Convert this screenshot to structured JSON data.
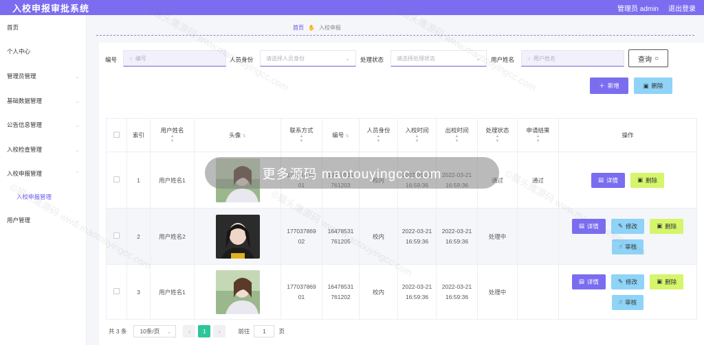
{
  "header": {
    "title": "入校申报审批系统",
    "admin_label": "管理员 admin",
    "logout_label": "退出登录"
  },
  "sidebar": {
    "items": [
      {
        "label": "首页"
      },
      {
        "label": "个人中心"
      },
      {
        "label": "管理员管理"
      },
      {
        "label": "基础数据管理"
      },
      {
        "label": "公告信息管理"
      },
      {
        "label": "入校检查管理"
      },
      {
        "label": "入校申报管理"
      },
      {
        "label": "用户管理"
      }
    ],
    "sub_active": "入校申报管理"
  },
  "breadcrumb": {
    "home": "首页",
    "current": "入校申报"
  },
  "search": {
    "label_no": "编号",
    "placeholder_no": "编号",
    "label_identity": "人员身份",
    "placeholder_identity": "请选择人员身份",
    "label_status": "处理状态",
    "placeholder_status": "请选择处理状态",
    "label_name": "用户姓名",
    "placeholder_name": "用户姓名",
    "query_label": "查询"
  },
  "actions": {
    "add_label": "新增",
    "delete_label": "删除"
  },
  "table": {
    "headers": {
      "index": "索引",
      "name": "用户姓名",
      "avatar": "头像",
      "phone": "联系方式",
      "no": "编号",
      "identity": "人员身份",
      "in_time": "入校时间",
      "out_time": "出校时间",
      "status": "处理状态",
      "result": "申请结果",
      "ops": "操作"
    },
    "rows": [
      {
        "index": "1",
        "name": "用户姓名1",
        "phone": "17703786901",
        "no": "16478531761203",
        "identity": "校内",
        "in_time": "2022-03-21 16:59:36",
        "out_time": "2022-03-21 16:59:36",
        "status": "通过",
        "result": "通过"
      },
      {
        "index": "2",
        "name": "用户姓名2",
        "phone": "17703786902",
        "no": "16478531761205",
        "identity": "校内",
        "in_time": "2022-03-21 16:59:36",
        "out_time": "2022-03-21 16:59:36",
        "status": "处理中",
        "result": ""
      },
      {
        "index": "3",
        "name": "用户姓名1",
        "phone": "17703786901",
        "no": "16478531761202",
        "identity": "校内",
        "in_time": "2022-03-21 16:59:36",
        "out_time": "2022-03-21 16:59:36",
        "status": "处理中",
        "result": ""
      }
    ],
    "op_labels": {
      "detail": "详情",
      "edit": "修改",
      "delete": "删除",
      "audit": "审核"
    }
  },
  "pager": {
    "total": "共 3 条",
    "size": "10条/页",
    "current": "1",
    "goto": "前往",
    "goto_value": "1",
    "page_unit": "页"
  },
  "overlay_text": "更多源码 maotouyingcc.com",
  "watermark_text": "©猫头鹰源码 www.maotouyingcc.com"
}
